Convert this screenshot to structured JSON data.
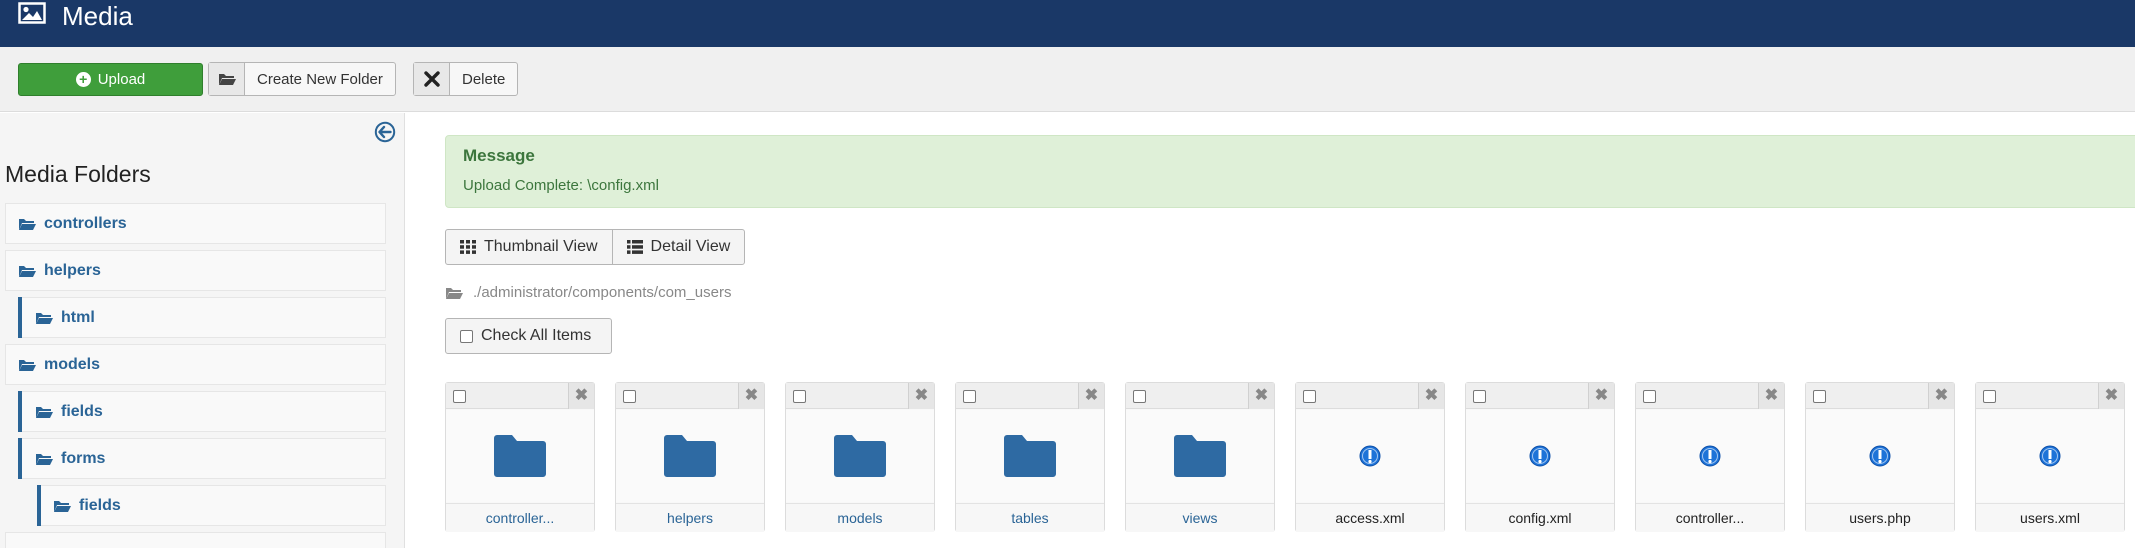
{
  "header": {
    "title": "Media",
    "icon": "image-icon"
  },
  "toolbar": {
    "upload_label": "Upload",
    "create_folder_label": "Create New Folder",
    "delete_label": "Delete"
  },
  "sidebar": {
    "title": "Media Folders",
    "folders": [
      {
        "label": "controllers",
        "level": 0
      },
      {
        "label": "helpers",
        "level": 0
      },
      {
        "label": "html",
        "level": 1
      },
      {
        "label": "models",
        "level": 0
      },
      {
        "label": "fields",
        "level": 1
      },
      {
        "label": "forms",
        "level": 1
      },
      {
        "label": "fields",
        "level": 2
      }
    ]
  },
  "alert": {
    "heading": "Message",
    "text": "Upload Complete: \\config.xml"
  },
  "views": {
    "thumbnail_label": "Thumbnail View",
    "detail_label": "Detail View"
  },
  "path": "./administrator/components/com_users",
  "check_all_label": "Check All Items",
  "items": [
    {
      "label": "controller...",
      "type": "folder"
    },
    {
      "label": "helpers",
      "type": "folder"
    },
    {
      "label": "models",
      "type": "folder"
    },
    {
      "label": "tables",
      "type": "folder"
    },
    {
      "label": "views",
      "type": "folder"
    },
    {
      "label": "access.xml",
      "type": "file"
    },
    {
      "label": "config.xml",
      "type": "file"
    },
    {
      "label": "controller...",
      "type": "file"
    },
    {
      "label": "users.php",
      "type": "file"
    },
    {
      "label": "users.xml",
      "type": "file"
    }
  ],
  "colors": {
    "header_bg": "#1a3867",
    "upload_green": "#3f9e3b",
    "link_blue": "#2a6496",
    "alert_bg": "#dff0d8",
    "alert_text": "#3c763d",
    "file_icon_blue": "#1e73d8"
  }
}
